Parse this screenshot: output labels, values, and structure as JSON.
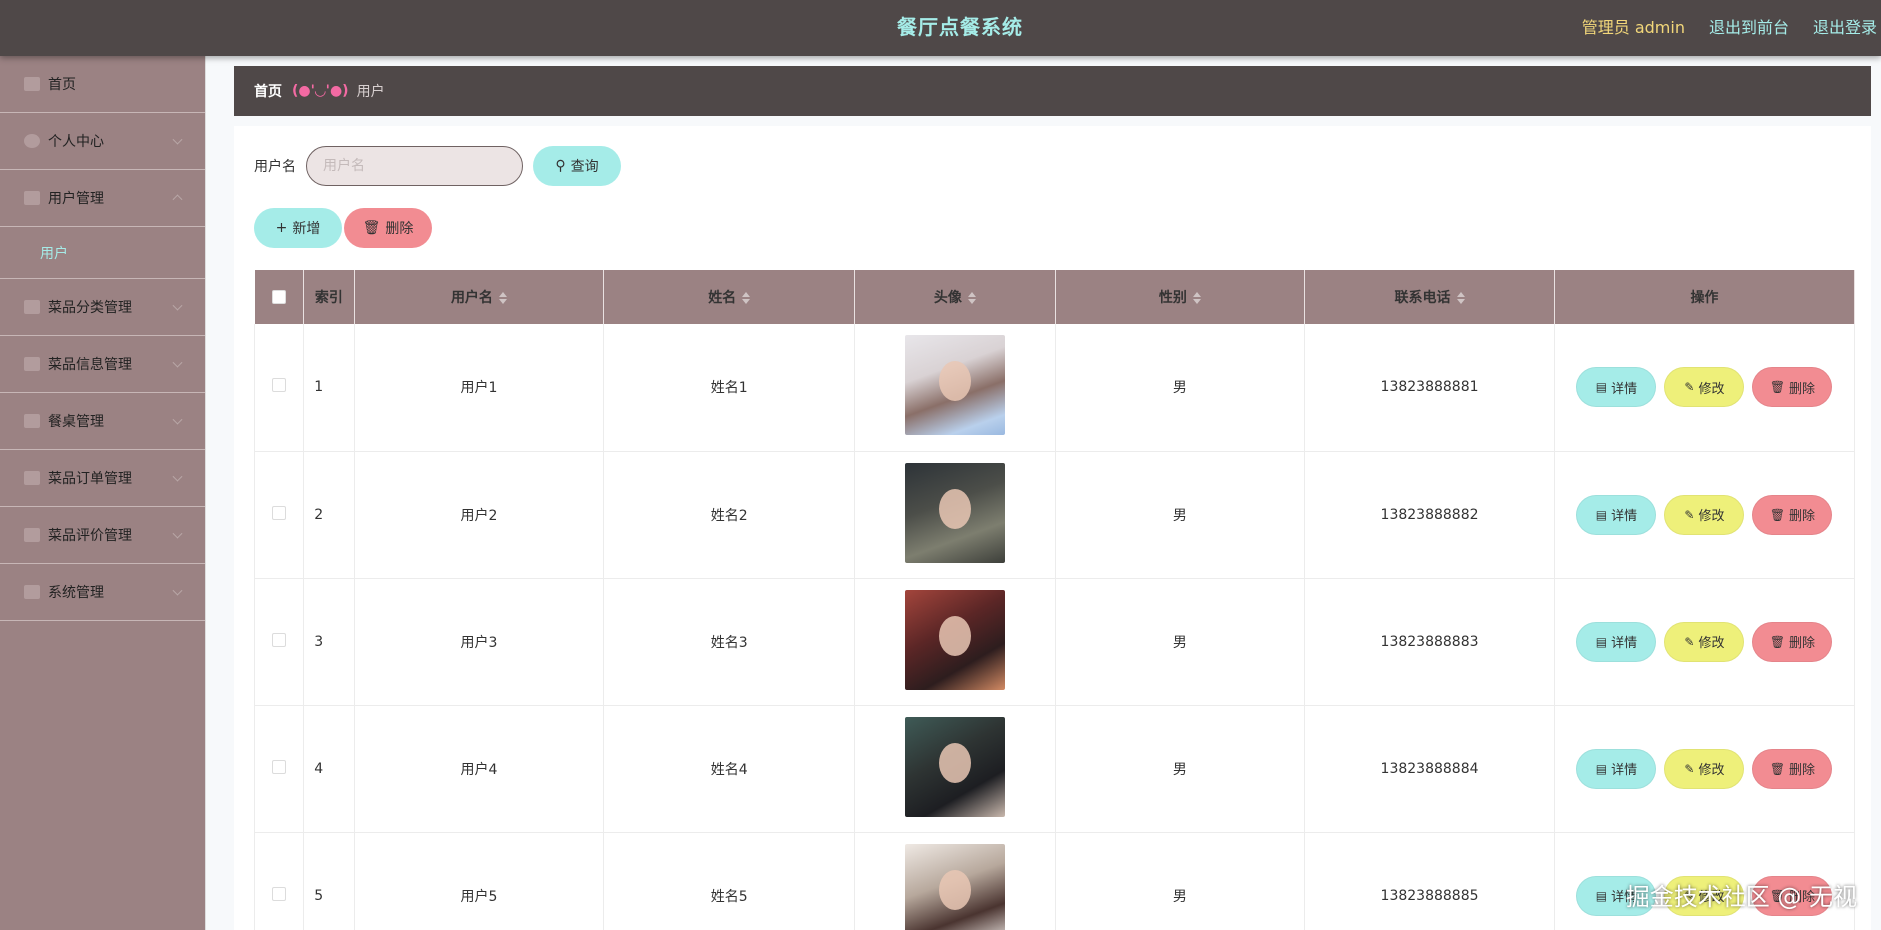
{
  "header": {
    "title": "餐厅点餐系统",
    "admin_label": "管理员 admin",
    "to_front": "退出到前台",
    "logout": "退出登录"
  },
  "sidebar": {
    "items": [
      {
        "label": "首页",
        "icon": "home-icon"
      },
      {
        "label": "个人中心",
        "icon": "user-icon"
      },
      {
        "label": "用户管理",
        "icon": "users-icon"
      },
      {
        "label": "菜品分类管理",
        "icon": "category-icon"
      },
      {
        "label": "菜品信息管理",
        "icon": "dish-icon"
      },
      {
        "label": "餐桌管理",
        "icon": "table-icon"
      },
      {
        "label": "菜品订单管理",
        "icon": "order-icon"
      },
      {
        "label": "菜品评价管理",
        "icon": "rating-icon"
      },
      {
        "label": "系统管理",
        "icon": "settings-icon"
      }
    ],
    "sub_item": "用户"
  },
  "breadcrumb": {
    "home": "首页",
    "separator": "(●'◡'●)",
    "current": "用户"
  },
  "search": {
    "label": "用户名",
    "placeholder": "用户名",
    "query_button": "查询"
  },
  "actions": {
    "add": "新增",
    "delete": "删除"
  },
  "table": {
    "columns": [
      "索引",
      "用户名",
      "姓名",
      "头像",
      "性别",
      "联系电话",
      "操作"
    ],
    "rows": [
      {
        "index": "1",
        "username": "用户1",
        "name": "姓名1",
        "gender": "男",
        "phone": "13823888881"
      },
      {
        "index": "2",
        "username": "用户2",
        "name": "姓名2",
        "gender": "男",
        "phone": "13823888882"
      },
      {
        "index": "3",
        "username": "用户3",
        "name": "姓名3",
        "gender": "男",
        "phone": "13823888883"
      },
      {
        "index": "4",
        "username": "用户4",
        "name": "姓名4",
        "gender": "男",
        "phone": "13823888884"
      },
      {
        "index": "5",
        "username": "用户5",
        "name": "姓名5",
        "gender": "男",
        "phone": "13823888885"
      }
    ],
    "row_actions": {
      "detail": "详情",
      "edit": "修改",
      "delete": "删除"
    }
  },
  "watermark": "掘金技术社区 @ 无视",
  "colors": {
    "header_bg": "#4f4848",
    "sidebar_bg": "#9b8283",
    "accent_cyan": "#a5ece8",
    "accent_yellow": "#eef07a",
    "accent_red": "#f28c92",
    "admin_text": "#f2d77a"
  }
}
